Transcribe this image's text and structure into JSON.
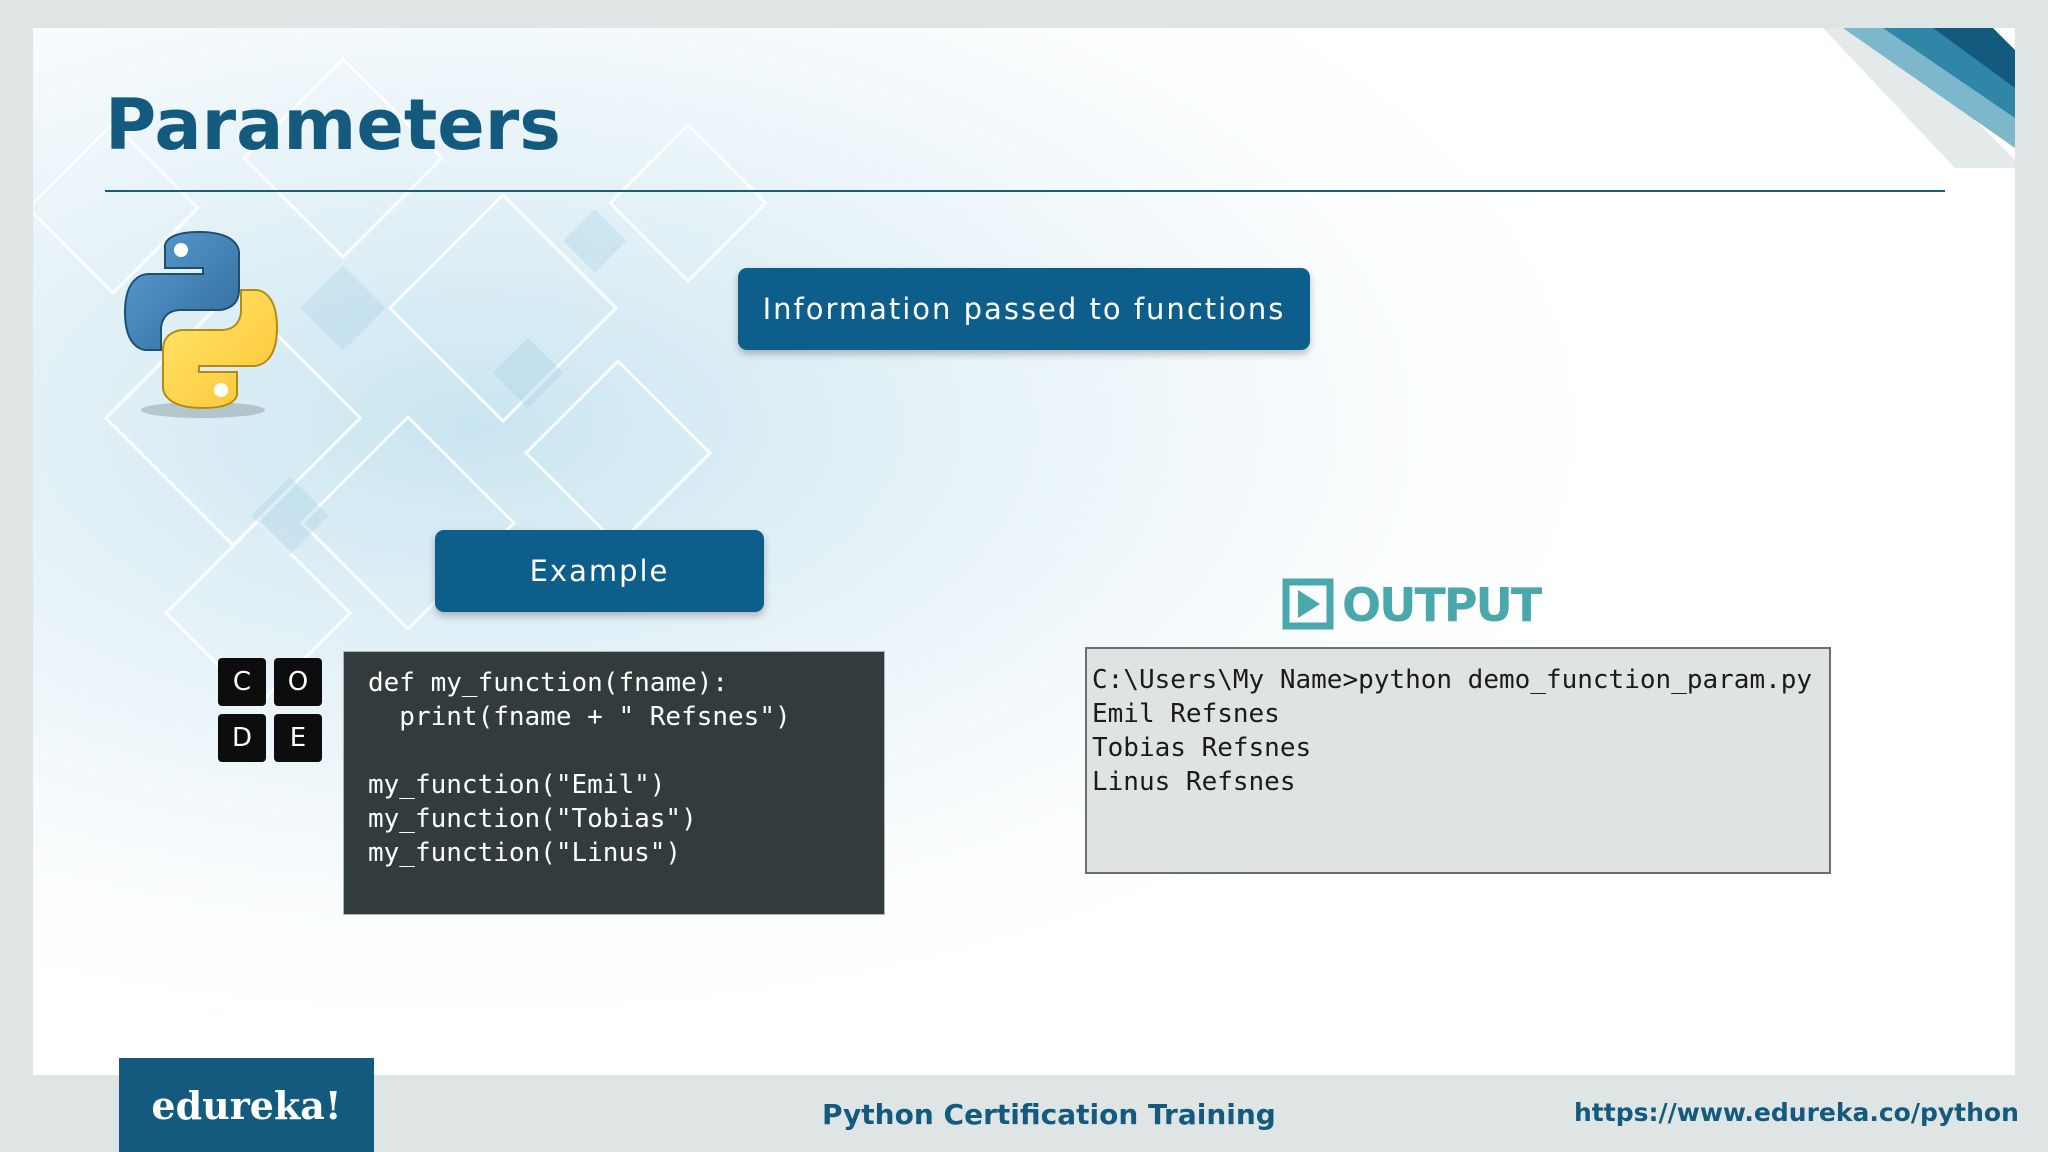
{
  "slide": {
    "title": "Parameters",
    "info_pill": "Information passed to functions",
    "example_pill": "Example"
  },
  "code_badge": {
    "letters": [
      "C",
      "O",
      "D",
      "E"
    ]
  },
  "code": {
    "lines": [
      "def my_function(fname):",
      "  print(fname + \" Refsnes\")",
      "",
      "my_function(\"Emil\")",
      "my_function(\"Tobias\")",
      "my_function(\"Linus\")"
    ]
  },
  "output": {
    "logo_text": "OUTPUT",
    "lines": [
      "C:\\Users\\My Name>python demo_function_param.py",
      "Emil Refsnes",
      "Tobias Refsnes",
      "Linus Refsnes"
    ]
  },
  "footer": {
    "logo": "edureka!",
    "course": "Python Certification Training",
    "url": "https://www.edureka.co/python"
  },
  "colors": {
    "brand_blue": "#135a7e",
    "pill_blue": "#0e5e8c",
    "output_teal": "#4aa8ad",
    "code_bg": "#333c3d",
    "output_bg": "#dfe3e3"
  },
  "icons": {
    "python": "python-logo-icon",
    "code": "code-badge-icon",
    "output": "output-play-icon"
  }
}
